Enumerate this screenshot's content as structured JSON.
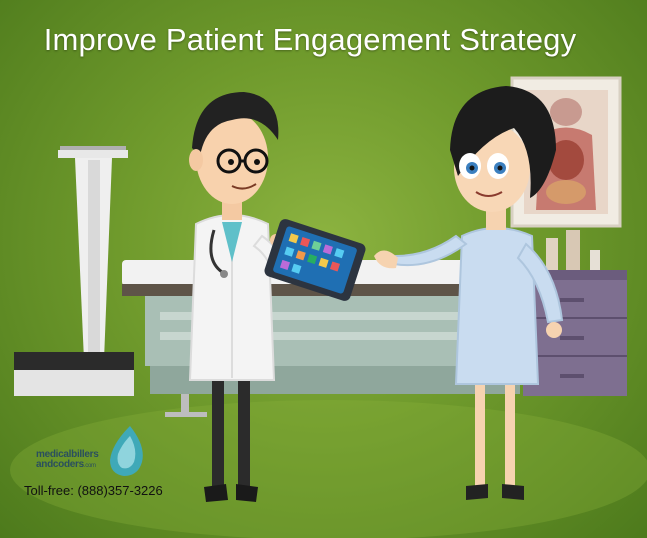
{
  "title": "Improve Patient Engagement Strategy",
  "logo": {
    "line1": "medicalbillers",
    "line2": "andcoders",
    "suffix": ".com"
  },
  "toll_free": "Toll-free: (888)357-3226",
  "icons": {
    "logo_mark": "droplet-logo-icon",
    "scale": "weighing-scale-icon",
    "tablet": "tablet-icon"
  },
  "colors": {
    "background": "#7aa534",
    "title_text": "#ffffff",
    "doctor_coat": "#f4f4f4",
    "patient_gown": "#c9dcf0",
    "cabinet": "#7e6f90",
    "logo_teal": "#3fa9b8"
  }
}
